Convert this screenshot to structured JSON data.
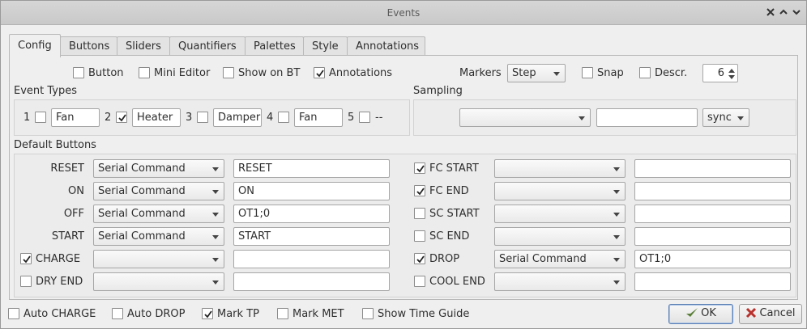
{
  "window": {
    "title": "Events"
  },
  "tabs": [
    "Config",
    "Buttons",
    "Sliders",
    "Quantifiers",
    "Palettes",
    "Style",
    "Annotations"
  ],
  "top_row": {
    "button_label": "Button",
    "mini_editor_label": "Mini Editor",
    "show_on_bt_label": "Show on BT",
    "annotations_label": "Annotations",
    "markers_label": "Markers",
    "markers_value": "Step",
    "snap_label": "Snap",
    "descr_label": "Descr.",
    "descr_value": "6"
  },
  "event_types": {
    "title": "Event Types",
    "items": [
      {
        "num": "1",
        "checked": false,
        "value": "Fan"
      },
      {
        "num": "2",
        "checked": true,
        "value": "Heater"
      },
      {
        "num": "3",
        "checked": false,
        "value": "Damper"
      },
      {
        "num": "4",
        "checked": false,
        "value": "Fan"
      },
      {
        "num": "5",
        "checked": false,
        "value": "--"
      }
    ]
  },
  "sampling": {
    "title": "Sampling",
    "combo_value": "",
    "field_value": "",
    "sync_value": "sync"
  },
  "default_buttons": {
    "title": "Default Buttons",
    "left": [
      {
        "label": "RESET",
        "has_checkbox": false,
        "checked": false,
        "action": "Serial Command",
        "command": "RESET"
      },
      {
        "label": "ON",
        "has_checkbox": false,
        "checked": false,
        "action": "Serial Command",
        "command": "ON"
      },
      {
        "label": "OFF",
        "has_checkbox": false,
        "checked": false,
        "action": "Serial Command",
        "command": "OT1;0"
      },
      {
        "label": "START",
        "has_checkbox": false,
        "checked": false,
        "action": "Serial Command",
        "command": "START"
      },
      {
        "label": "CHARGE",
        "has_checkbox": true,
        "checked": true,
        "action": "",
        "command": ""
      },
      {
        "label": "DRY END",
        "has_checkbox": true,
        "checked": false,
        "action": "",
        "command": ""
      }
    ],
    "right": [
      {
        "label": "FC START",
        "checked": true,
        "action": "",
        "command": ""
      },
      {
        "label": "FC END",
        "checked": true,
        "action": "",
        "command": ""
      },
      {
        "label": "SC START",
        "checked": false,
        "action": "",
        "command": ""
      },
      {
        "label": "SC END",
        "checked": false,
        "action": "",
        "command": ""
      },
      {
        "label": "DROP",
        "checked": true,
        "action": "Serial Command",
        "command": "OT1;0"
      },
      {
        "label": "COOL END",
        "checked": false,
        "action": "",
        "command": ""
      }
    ]
  },
  "bottom": {
    "auto_charge_label": "Auto CHARGE",
    "auto_drop_label": "Auto DROP",
    "mark_tp_label": "Mark TP",
    "mark_met_label": "Mark MET",
    "show_time_guide_label": "Show Time Guide",
    "ok_label": "OK",
    "cancel_label": "Cancel"
  },
  "icons": {
    "ok": "checkmark-icon",
    "cancel": "x-icon"
  },
  "colors": {
    "ok_check": "#5c7f3a",
    "cancel_x": "#b8312c",
    "focus_border": "#5a7fb3"
  }
}
